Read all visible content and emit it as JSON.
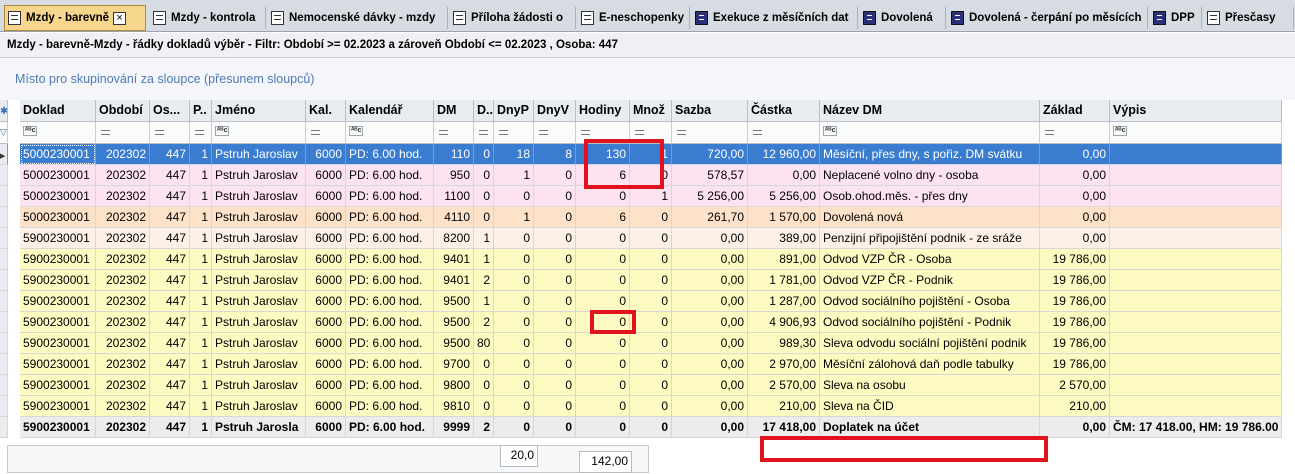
{
  "tabs": [
    {
      "label": "Mzdy - barevně",
      "active": true,
      "icon": "document-list-icon"
    },
    {
      "label": "Mzdy - kontrola",
      "active": false,
      "icon": "document-list-icon"
    },
    {
      "label": "Nemocenské dávky - mzdy",
      "active": false,
      "icon": "document-list-icon"
    },
    {
      "label": "Příloha žádosti o",
      "active": false,
      "icon": "document-list-icon"
    },
    {
      "label": "E-neschopenky",
      "active": false,
      "icon": "document-list-icon"
    },
    {
      "label": "Exekuce z měsíčních dat",
      "active": false,
      "icon": "report-icon"
    },
    {
      "label": "Dovolená",
      "active": false,
      "icon": "report-icon"
    },
    {
      "label": "Dovolená - čerpání po měsících",
      "active": false,
      "icon": "report-icon"
    },
    {
      "label": "DPP",
      "active": false,
      "icon": "report-icon"
    },
    {
      "label": "Přesčasy",
      "active": false,
      "icon": "document-list-icon"
    }
  ],
  "caption": "Mzdy - barevně-Mzdy - řádky dokladů výběr  -  Filtr: Období >= 02.2023  a zároveň  Období <= 02.2023 , Osoba: 447",
  "group_hint": "Místo pro skupinování za sloupce (přesunem sloupců)",
  "columns": [
    "Doklad",
    "Období",
    "Os...",
    "P..",
    "Jméno",
    "Kal.",
    "Kalendář",
    "DM",
    "D..",
    "DnyP",
    "DnyV",
    "Hodiny",
    "Množ",
    "Sazba",
    "Částka",
    "Název DM",
    "Základ",
    "Výpis"
  ],
  "filter_icons": [
    "abc",
    "eq",
    "eq",
    "eq",
    "abc",
    "eq",
    "abc",
    "eq",
    "eq",
    "eq",
    "eq",
    "eq",
    "eq",
    "eq",
    "eq",
    "abc",
    "eq",
    "abc"
  ],
  "rows": [
    {
      "cells": [
        "5000230001",
        "202302",
        "447",
        "1",
        "Pstruh Jaroslav",
        "6000",
        "PD: 6.00 hod.",
        "110",
        "0",
        "18",
        "8",
        "130",
        "1",
        "720,00",
        "12 960,00",
        "Měsíční, přes dny, s pořiz. DM svátku",
        "0,00",
        ""
      ],
      "color": "#ffffff",
      "selected": true
    },
    {
      "cells": [
        "5000230001",
        "202302",
        "447",
        "1",
        "Pstruh Jaroslav",
        "6000",
        "PD: 6.00 hod.",
        "950",
        "0",
        "1",
        "0",
        "6",
        "0",
        "578,57",
        "0,00",
        "Neplacené volno dny - osoba",
        "0,00",
        ""
      ],
      "color": "#fde3f1",
      "selected": false
    },
    {
      "cells": [
        "5000230001",
        "202302",
        "447",
        "1",
        "Pstruh Jaroslav",
        "6000",
        "PD: 6.00 hod.",
        "1100",
        "0",
        "0",
        "0",
        "0",
        "1",
        "5 256,00",
        "5 256,00",
        "Osob.ohod.měs. - přes dny",
        "0,00",
        ""
      ],
      "color": "#fde3f1",
      "selected": false
    },
    {
      "cells": [
        "5000230001",
        "202302",
        "447",
        "1",
        "Pstruh Jaroslav",
        "6000",
        "PD: 6.00 hod.",
        "4110",
        "0",
        "1",
        "0",
        "6",
        "0",
        "261,70",
        "1 570,00",
        "Dovolená nová",
        "0,00",
        ""
      ],
      "color": "#fde1c9",
      "selected": false
    },
    {
      "cells": [
        "5900230001",
        "202302",
        "447",
        "1",
        "Pstruh Jaroslav",
        "6000",
        "PD: 6.00 hod.",
        "8200",
        "1",
        "0",
        "0",
        "0",
        "0",
        "0,00",
        "389,00",
        "Penzijní připojištění podnik - ze sráže",
        "0,00",
        ""
      ],
      "color": "#fdf0e6",
      "selected": false
    },
    {
      "cells": [
        "5900230001",
        "202302",
        "447",
        "1",
        "Pstruh Jaroslav",
        "6000",
        "PD: 6.00 hod.",
        "9401",
        "1",
        "0",
        "0",
        "0",
        "0",
        "0,00",
        "891,00",
        "Odvod VZP ČR - Osoba",
        "19 786,00",
        ""
      ],
      "color": "#fdfac2",
      "selected": false
    },
    {
      "cells": [
        "5900230001",
        "202302",
        "447",
        "1",
        "Pstruh Jaroslav",
        "6000",
        "PD: 6.00 hod.",
        "9401",
        "2",
        "0",
        "0",
        "0",
        "0",
        "0,00",
        "1 781,00",
        "Odvod VZP ČR - Podnik",
        "19 786,00",
        ""
      ],
      "color": "#fdfac2",
      "selected": false
    },
    {
      "cells": [
        "5900230001",
        "202302",
        "447",
        "1",
        "Pstruh Jaroslav",
        "6000",
        "PD: 6.00 hod.",
        "9500",
        "1",
        "0",
        "0",
        "0",
        "0",
        "0,00",
        "1 287,00",
        "Odvod sociálního pojištění - Osoba",
        "19 786,00",
        ""
      ],
      "color": "#fdfac2",
      "selected": false
    },
    {
      "cells": [
        "5900230001",
        "202302",
        "447",
        "1",
        "Pstruh Jaroslav",
        "6000",
        "PD: 6.00 hod.",
        "9500",
        "2",
        "0",
        "0",
        "0",
        "0",
        "0,00",
        "4 906,93",
        "Odvod sociálního pojištění - Podnik",
        "19 786,00",
        ""
      ],
      "color": "#fdfac2",
      "selected": false
    },
    {
      "cells": [
        "5900230001",
        "202302",
        "447",
        "1",
        "Pstruh Jaroslav",
        "6000",
        "PD: 6.00 hod.",
        "9500",
        "80",
        "0",
        "0",
        "0",
        "0",
        "0,00",
        "989,30",
        "Sleva odvodu sociální pojištění podnik",
        "19 786,00",
        ""
      ],
      "color": "#fdfac2",
      "selected": false
    },
    {
      "cells": [
        "5900230001",
        "202302",
        "447",
        "1",
        "Pstruh Jaroslav",
        "6000",
        "PD: 6.00 hod.",
        "9700",
        "0",
        "0",
        "0",
        "0",
        "0",
        "0,00",
        "2 970,00",
        "Měsíční zálohová daň podle tabulky",
        "19 786,00",
        ""
      ],
      "color": "#fdfac2",
      "selected": false
    },
    {
      "cells": [
        "5900230001",
        "202302",
        "447",
        "1",
        "Pstruh Jaroslav",
        "6000",
        "PD: 6.00 hod.",
        "9800",
        "0",
        "0",
        "0",
        "0",
        "0",
        "0,00",
        "2 570,00",
        "Sleva na osobu",
        "2 570,00",
        ""
      ],
      "color": "#fdfac2",
      "selected": false
    },
    {
      "cells": [
        "5900230001",
        "202302",
        "447",
        "1",
        "Pstruh Jaroslav",
        "6000",
        "PD: 6.00 hod.",
        "9810",
        "0",
        "0",
        "0",
        "0",
        "0",
        "0,00",
        "210,00",
        "Sleva na ČID",
        "210,00",
        ""
      ],
      "color": "#fdfac2",
      "selected": false
    },
    {
      "cells": [
        "5900230001",
        "202302",
        "447",
        "1",
        "Pstruh Jarosla",
        "6000",
        "PD: 6.00 hod.",
        "9999",
        "2",
        "0",
        "0",
        "0",
        "0",
        "0,00",
        "17 418,00",
        "Doplatek na účet",
        "0,00",
        "ČM: 17 418.00, HM: 19 786.00"
      ],
      "color": "#ececec",
      "selected": false,
      "total": true
    }
  ],
  "summary": {
    "dnyv_total": "20,0",
    "hodiny_total": "142,00"
  },
  "colors": {
    "selected": "#3a7dd0",
    "highlight": "#e0121b",
    "active_tab": "#f6d58c"
  }
}
